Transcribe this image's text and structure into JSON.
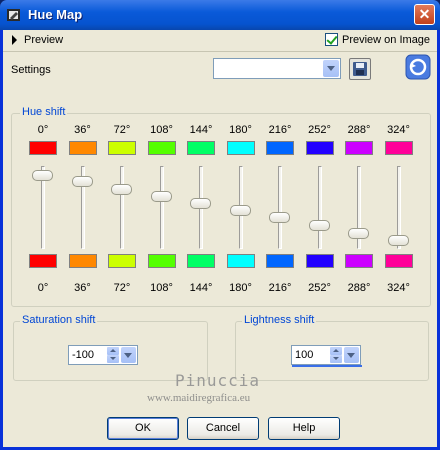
{
  "window": {
    "title": "Hue Map",
    "app_icon": "paint-shop-icon",
    "close_icon": "close-icon"
  },
  "preview": {
    "label": "Preview",
    "preview_on_image_label": "Preview on Image",
    "preview_on_image_checked": true
  },
  "settings": {
    "label": "Settings",
    "preset_value": "",
    "save_icon": "floppy-disk-icon",
    "reset_icon": "reset-icon"
  },
  "hue_shift": {
    "title": "Hue shift",
    "channels": [
      {
        "top_label": "0°",
        "bottom_label": "0°",
        "top_color": "#ff0000",
        "bottom_color": "#ff0000",
        "slider_value": 0.05
      },
      {
        "top_label": "36°",
        "bottom_label": "36°",
        "top_color": "#ff8800",
        "bottom_color": "#ff8800",
        "slider_value": 0.13
      },
      {
        "top_label": "72°",
        "bottom_label": "72°",
        "top_color": "#ccff00",
        "bottom_color": "#ccff00",
        "slider_value": 0.22
      },
      {
        "top_label": "108°",
        "bottom_label": "108°",
        "top_color": "#55ff00",
        "bottom_color": "#55ff00",
        "slider_value": 0.31
      },
      {
        "top_label": "144°",
        "bottom_label": "144°",
        "top_color": "#00ff66",
        "bottom_color": "#00ff66",
        "slider_value": 0.4
      },
      {
        "top_label": "180°",
        "bottom_label": "180°",
        "top_color": "#00ffff",
        "bottom_color": "#00ffff",
        "slider_value": 0.49
      },
      {
        "top_label": "216°",
        "bottom_label": "216°",
        "top_color": "#0066ff",
        "bottom_color": "#0066ff",
        "slider_value": 0.58
      },
      {
        "top_label": "252°",
        "bottom_label": "252°",
        "top_color": "#2200ff",
        "bottom_color": "#2200ff",
        "slider_value": 0.68
      },
      {
        "top_label": "288°",
        "bottom_label": "288°",
        "top_color": "#cc00ff",
        "bottom_color": "#cc00ff",
        "slider_value": 0.77
      },
      {
        "top_label": "324°",
        "bottom_label": "324°",
        "top_color": "#ff0099",
        "bottom_color": "#ff0099",
        "slider_value": 0.86
      }
    ]
  },
  "saturation_shift": {
    "title": "Saturation shift",
    "value": "-100"
  },
  "lightness_shift": {
    "title": "Lightness shift",
    "value": "100"
  },
  "watermark": {
    "line1": "Pinuccia",
    "line2": "www.maidiregrafica.eu"
  },
  "buttons": {
    "ok": "OK",
    "cancel": "Cancel",
    "help": "Help"
  },
  "colors": {
    "titlebar": "#0a5ad9",
    "group_title": "#0046d5",
    "face": "#ece9d8"
  }
}
